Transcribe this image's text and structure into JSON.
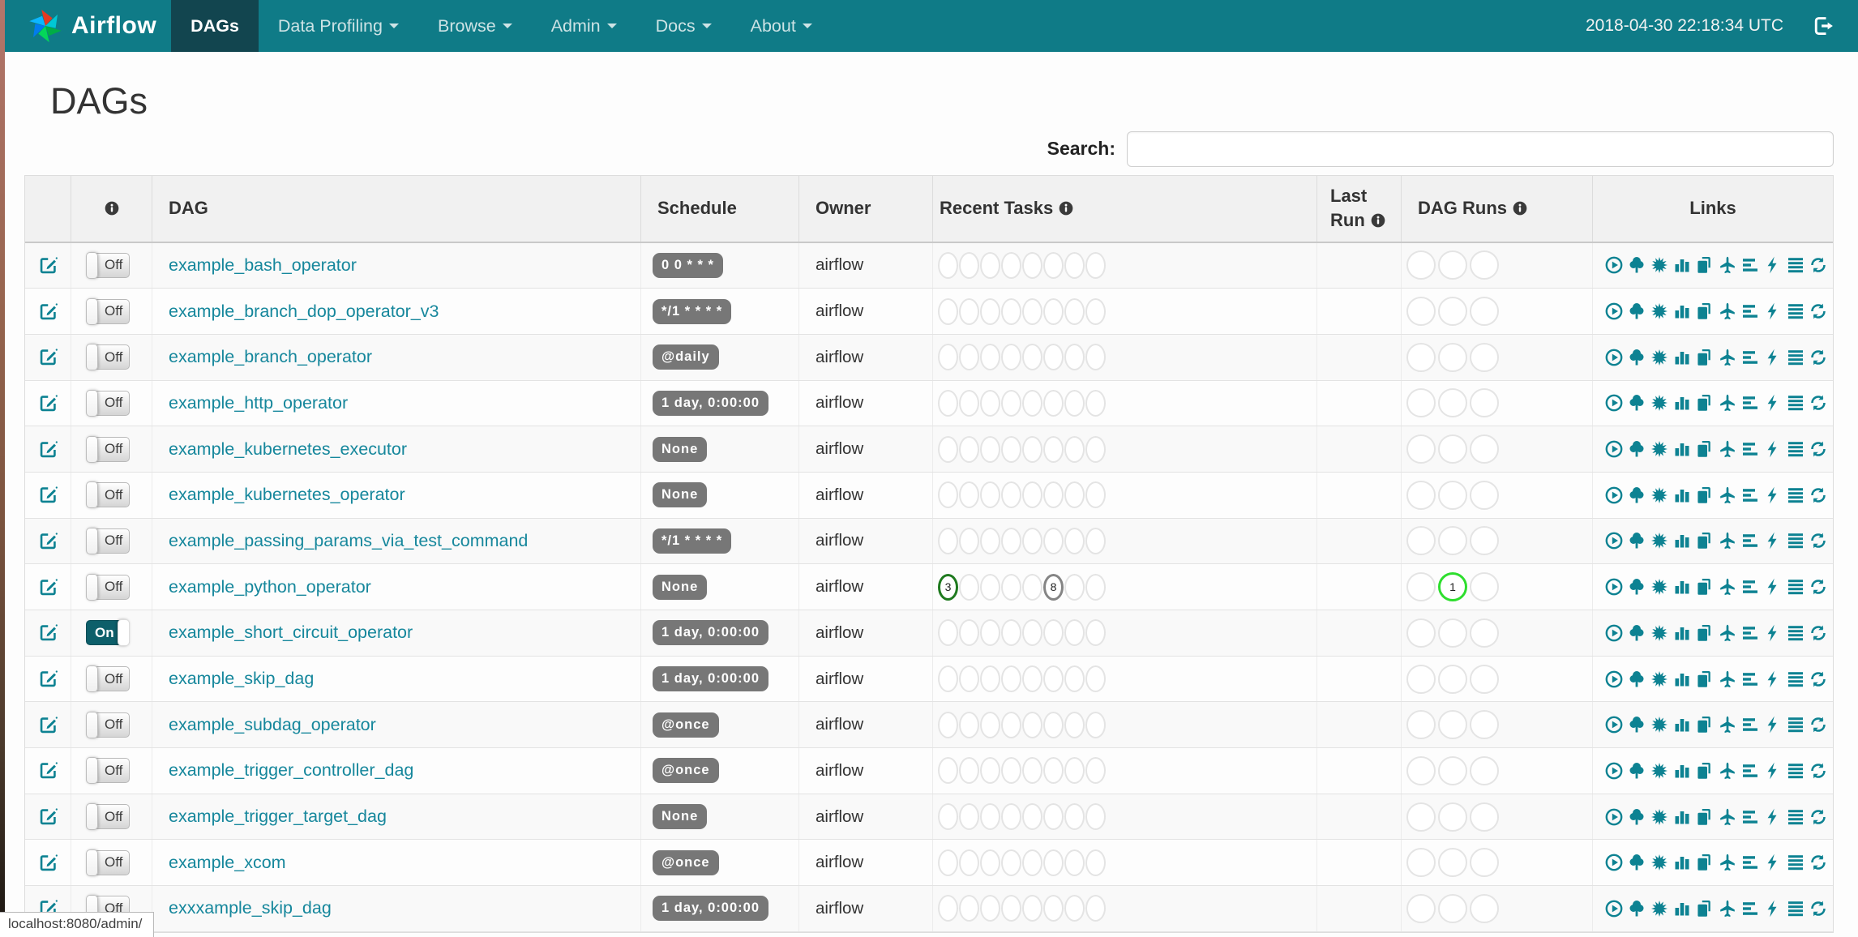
{
  "navbar": {
    "brand": "Airflow",
    "items": [
      {
        "label": "DAGs",
        "active": true,
        "caret": false
      },
      {
        "label": "Data Profiling",
        "active": false,
        "caret": true
      },
      {
        "label": "Browse",
        "active": false,
        "caret": true
      },
      {
        "label": "Admin",
        "active": false,
        "caret": true
      },
      {
        "label": "Docs",
        "active": false,
        "caret": true
      },
      {
        "label": "About",
        "active": false,
        "caret": true
      }
    ],
    "clock": "2018-04-30 22:18:34 UTC"
  },
  "page": {
    "title": "DAGs",
    "search_label": "Search:",
    "search_value": "",
    "status_bar": "localhost:8080/admin/"
  },
  "table": {
    "headers": {
      "dag": "DAG",
      "schedule": "Schedule",
      "owner": "Owner",
      "recent_tasks": "Recent Tasks",
      "last_run": "Last Run",
      "dag_runs": "DAG Runs",
      "links": "Links"
    },
    "toggle": {
      "on_label": "On",
      "off_label": "Off"
    },
    "recent_task_slots": 8,
    "dag_run_slots": 3,
    "links": [
      {
        "name": "trigger-dag",
        "icon": "i-play"
      },
      {
        "name": "tree-view",
        "icon": "i-tree"
      },
      {
        "name": "graph-view",
        "icon": "i-graph"
      },
      {
        "name": "task-duration",
        "icon": "i-duration"
      },
      {
        "name": "task-tries",
        "icon": "i-tries"
      },
      {
        "name": "landing-times",
        "icon": "i-landing"
      },
      {
        "name": "gantt-view",
        "icon": "i-gantt"
      },
      {
        "name": "code-view",
        "icon": "i-code"
      },
      {
        "name": "logs",
        "icon": "i-logs"
      },
      {
        "name": "refresh",
        "icon": "i-refresh"
      }
    ],
    "rows": [
      {
        "name": "example_bash_operator",
        "schedule": "0 0 * * *",
        "owner": "airflow",
        "enabled": false
      },
      {
        "name": "example_branch_dop_operator_v3",
        "schedule": "*/1 * * * *",
        "owner": "airflow",
        "enabled": false
      },
      {
        "name": "example_branch_operator",
        "schedule": "@daily",
        "owner": "airflow",
        "enabled": false
      },
      {
        "name": "example_http_operator",
        "schedule": "1 day, 0:00:00",
        "owner": "airflow",
        "enabled": false
      },
      {
        "name": "example_kubernetes_executor",
        "schedule": "None",
        "owner": "airflow",
        "enabled": false
      },
      {
        "name": "example_kubernetes_operator",
        "schedule": "None",
        "owner": "airflow",
        "enabled": false
      },
      {
        "name": "example_passing_params_via_test_command",
        "schedule": "*/1 * * * *",
        "owner": "airflow",
        "enabled": false
      },
      {
        "name": "example_python_operator",
        "schedule": "None",
        "owner": "airflow",
        "enabled": false,
        "recent_tasks": [
          {
            "slot": 0,
            "count": "3",
            "color_key": "success"
          },
          {
            "slot": 5,
            "count": "8",
            "color_key": "grey"
          }
        ],
        "dag_runs": [
          {
            "slot": 1,
            "count": "1",
            "color_key": "running"
          }
        ]
      },
      {
        "name": "example_short_circuit_operator",
        "schedule": "1 day, 0:00:00",
        "owner": "airflow",
        "enabled": true
      },
      {
        "name": "example_skip_dag",
        "schedule": "1 day, 0:00:00",
        "owner": "airflow",
        "enabled": false
      },
      {
        "name": "example_subdag_operator",
        "schedule": "@once",
        "owner": "airflow",
        "enabled": false
      },
      {
        "name": "example_trigger_controller_dag",
        "schedule": "@once",
        "owner": "airflow",
        "enabled": false
      },
      {
        "name": "example_trigger_target_dag",
        "schedule": "None",
        "owner": "airflow",
        "enabled": false
      },
      {
        "name": "example_xcom",
        "schedule": "@once",
        "owner": "airflow",
        "enabled": false
      },
      {
        "name": "exxxample_skip_dag",
        "schedule": "1 day, 0:00:00",
        "owner": "airflow",
        "enabled": false
      }
    ]
  },
  "colors": {
    "navbar_teal": "#0f7b87",
    "active_tab": "#12454f",
    "icon_teal": "#0d8292",
    "link_teal": "#16879c",
    "badge_grey": "#777777",
    "success": "#1f7a1f",
    "grey": "#858585",
    "running": "#2ede2e"
  }
}
